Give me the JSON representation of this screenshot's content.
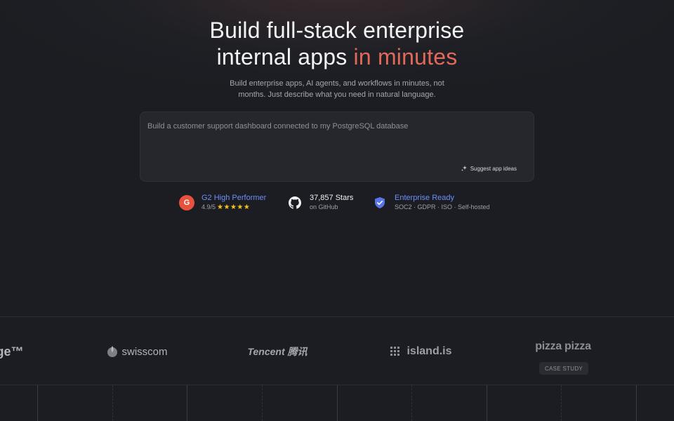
{
  "hero": {
    "title_line1": "Build full-stack enterprise",
    "title_line2_prefix": "internal apps ",
    "title_line2_accent": "in minutes",
    "subtitle": "Build enterprise apps, AI agents, and workflows in minutes, not months. Just describe what you need in natural language."
  },
  "prompt": {
    "placeholder": "Build a customer support dashboard connected to my PostgreSQL database",
    "suggest_label": "Suggest app ideas",
    "suggest_icon": "sparkle-icon"
  },
  "badges": [
    {
      "icon": "g2-icon",
      "icon_letter": "G",
      "title": "G2 High Performer",
      "subtitle": "4.9/5",
      "stars": "★★★★★"
    },
    {
      "icon": "github-icon",
      "title": "37,857 Stars",
      "subtitle": "on GitHub"
    },
    {
      "icon": "shield-check-icon",
      "title": "Enterprise Ready",
      "subtitle": "SOC2 · GDPR · ISO · Self-hosted"
    }
  ],
  "logos": {
    "partial": "ge™",
    "swisscom": "swisscom",
    "tencent": "Tencent 腾讯",
    "island": "island.is",
    "pizza": "pizza pizza",
    "case_study": "CASE STUDY"
  },
  "colors": {
    "accent": "#e2685a",
    "link": "#6e8ef5",
    "background": "#1b1d22",
    "stars": "#f5c21b"
  }
}
